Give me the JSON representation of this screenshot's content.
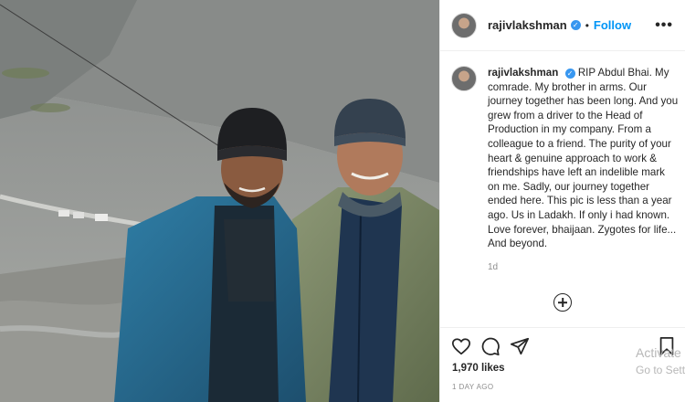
{
  "post": {
    "username": "rajivlakshman",
    "verified_mark": "✓",
    "separator": "•",
    "follow_label": "Follow",
    "more_label": "•••",
    "caption": "RIP Abdul Bhai. My comrade. My brother in arms. Our journey together has been long. And you grew from a driver to the Head of Production in my company. From a colleague to a friend. The purity of your heart & genuine approach to work & friendships have left an indelible mark on me. Sadly, our journey together ended here. This pic is less than a year ago. Us in Ladakh. If only i had known.\nLove forever, bhaijaan. Zygotes for life... And beyond.",
    "caption_age": "1d",
    "likes": "1,970 likes",
    "posted": "1 DAY AGO"
  },
  "icons": {
    "like": "heart-icon",
    "comment": "comment-icon",
    "share": "share-icon",
    "save": "bookmark-icon",
    "add_comment": "add-comment-icon",
    "more": "more-options-icon",
    "verified": "verified-badge-icon"
  },
  "watermark": {
    "line1": "Activate",
    "line2": "Go to Sett"
  },
  "colors": {
    "accent": "#0095f6",
    "verified": "#3897f0",
    "text": "#262626",
    "muted": "#8e8e8e"
  }
}
